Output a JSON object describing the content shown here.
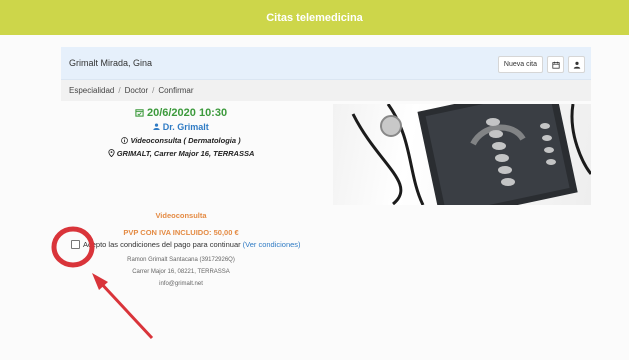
{
  "app": {
    "title": "Citas telemedicina"
  },
  "patient": {
    "name": "Grimalt Mirada, Gina",
    "new_appointment_label": "Nueva cita"
  },
  "breadcrumb": [
    "Especialidad",
    "Doctor",
    "Confirmar"
  ],
  "appointment": {
    "datetime": "20/6/2020 10:30",
    "doctor": "Dr. Grimalt",
    "type": "Videoconsulta ( Dermatologia )",
    "address": "GRIMALT, Carrer Major 16, TERRASSA"
  },
  "payment": {
    "type": "Videoconsulta",
    "price": "PVP CON IVA INCLUIDO: 50,00 €",
    "terms_text": "Acepto las condiciones del pago para continuar",
    "terms_link": "(Ver condiciones)",
    "accepted": false
  },
  "company": {
    "name": "Ramon Grimalt Santacana (39172926Q)",
    "address": "Carrer Major 16, 08221, TERRASSA",
    "email": "info@grimalt.net"
  },
  "colors": {
    "header": "#cdd64a",
    "date": "#3c9a3c",
    "doctor": "#2f7bc4",
    "price": "#e48b44",
    "annotation": "#d9343a"
  },
  "icons": {
    "calendar": "calendar-icon",
    "user": "user-icon",
    "info": "info-icon",
    "location": "map-pin-icon"
  }
}
